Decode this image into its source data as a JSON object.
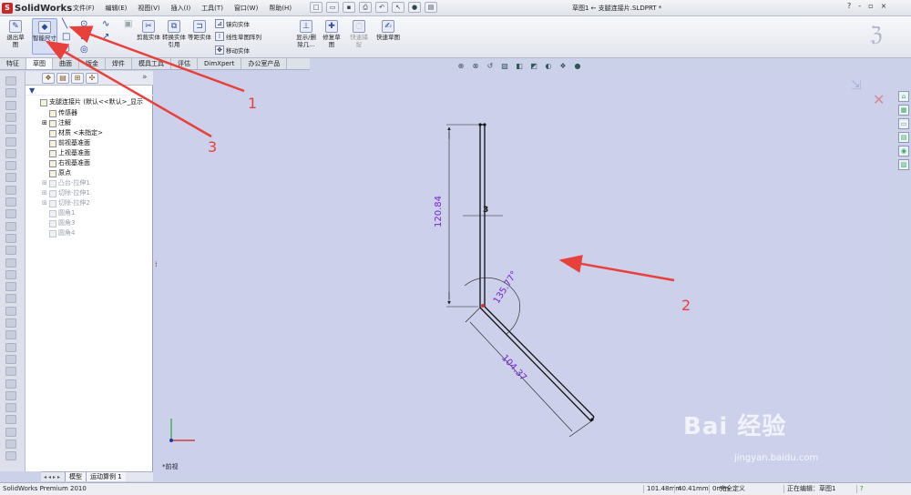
{
  "app": {
    "name": "SolidWorks",
    "document_title": "草图1 ← 支腿连接片.SLDPRT *"
  },
  "menu": {
    "items": [
      "文件(F)",
      "编辑(E)",
      "视图(V)",
      "插入(I)",
      "工具(T)",
      "窗口(W)",
      "帮助(H)"
    ]
  },
  "window_controls": {
    "help": "?",
    "minimize": "-",
    "restore": "▫",
    "close": "×"
  },
  "ribbon": {
    "exit_sketch": "退出草图",
    "smart_dim": "智能尺寸",
    "trim": "剪裁实体",
    "convert": "转换实体引用",
    "offset": "等距实体",
    "mirror": "镜向实体",
    "linear_pattern": "线性草图阵列",
    "move": "移动实体",
    "display_delete": "显示/删除几...",
    "repair": "修复草图",
    "quick_snap": "快速捕捉",
    "rapid_sketch": "快速草图"
  },
  "command_tabs": [
    "特征",
    "草图",
    "曲面",
    "钣金",
    "焊件",
    "模具工具",
    "评估",
    "DimXpert",
    "办公室产品"
  ],
  "command_tabs_active": "草图",
  "feature_tree": {
    "root": "支腿连接片 (默认<<默认>_显示",
    "items": [
      {
        "label": "传感器",
        "state": "normal"
      },
      {
        "label": "注解",
        "state": "normal"
      },
      {
        "label": "材质 <未指定>",
        "state": "normal"
      },
      {
        "label": "前视基准面",
        "state": "normal"
      },
      {
        "label": "上视基准面",
        "state": "normal"
      },
      {
        "label": "右视基准面",
        "state": "normal"
      },
      {
        "label": "原点",
        "state": "normal"
      },
      {
        "label": "凸台-拉伸1",
        "state": "gray"
      },
      {
        "label": "切除-拉伸1",
        "state": "gray"
      },
      {
        "label": "切除-拉伸2",
        "state": "gray"
      },
      {
        "label": "圆角1",
        "state": "gray"
      },
      {
        "label": "圆角3",
        "state": "gray"
      },
      {
        "label": "圆角4",
        "state": "gray"
      }
    ]
  },
  "fm_bottom_tabs": [
    "模型",
    "运动算例 1"
  ],
  "sketch": {
    "dim_vertical": "120.84",
    "dim_angle": "135.77°",
    "dim_slanted": "104.37",
    "relation": "3",
    "view_name": "*前视"
  },
  "annotations": {
    "arrow1": "1",
    "arrow2": "2",
    "arrow3": "3"
  },
  "statusbar": {
    "product": "SolidWorks Premium 2010",
    "x": "101.48mm",
    "y": "40.41mm",
    "z": "0mm",
    "state": "完全定义",
    "editing": "正在编辑：草图1",
    "help": "?"
  },
  "watermark": {
    "brand": "Bai 经验",
    "url": "jingyan.baidu.com"
  },
  "colors": {
    "annotation_red": "#e8403a",
    "dimension_purple": "#7a1fd6",
    "canvas": "#ccd0ea"
  }
}
